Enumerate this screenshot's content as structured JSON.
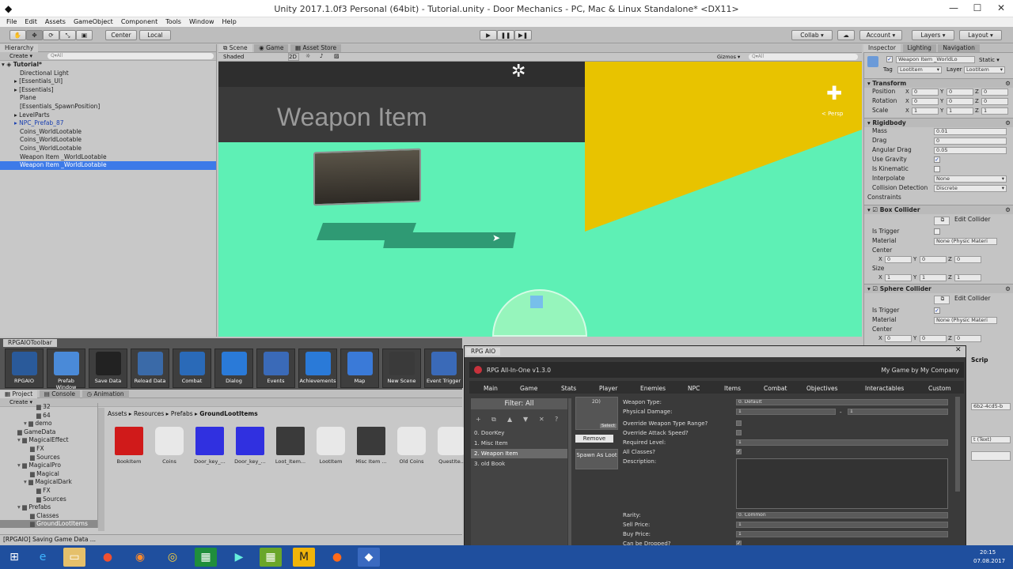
{
  "window": {
    "title": "Unity 2017.1.0f3 Personal (64bit) - Tutorial.unity - Door Mechanics - PC, Mac & Linux Standalone* <DX11>"
  },
  "menu": [
    "File",
    "Edit",
    "Assets",
    "GameObject",
    "Component",
    "Tools",
    "Window",
    "Help"
  ],
  "toolbar": {
    "pivot": "Center",
    "space": "Local",
    "collab": "Collab ▾",
    "account": "Account ▾",
    "layers": "Layers ▾",
    "layout": "Layout ▾"
  },
  "hierarchy": {
    "tab": "Hierarchy",
    "create": "Create ▾",
    "search": "Q▾All",
    "root": "Tutorial*",
    "items": [
      {
        "label": "Directional Light",
        "style": ""
      },
      {
        "label": "[Essentials_UI]",
        "style": ""
      },
      {
        "label": "[Essentials]",
        "style": ""
      },
      {
        "label": "Plane",
        "style": ""
      },
      {
        "label": "[Essentials_SpawnPosition]",
        "style": ""
      },
      {
        "label": "LevelParts",
        "style": ""
      },
      {
        "label": "NPC_Prefab_87",
        "style": "blue"
      },
      {
        "label": "Coins_WorldLootable",
        "style": ""
      },
      {
        "label": "Coins_WorldLootable",
        "style": ""
      },
      {
        "label": "Coins_WorldLootable",
        "style": ""
      },
      {
        "label": "Weapon Item _WorldLootable",
        "style": ""
      },
      {
        "label": "Weapon Item _WorldLootable",
        "style": "sel"
      }
    ]
  },
  "scene": {
    "tabs": [
      "Scene",
      "Game",
      "Asset Store"
    ],
    "shading": "Shaded",
    "mode2d": "2D",
    "gizmos": "Gizmos ▾",
    "search": "Q▾All",
    "label3d": "Weapon Item",
    "persp": "< Persp"
  },
  "inspector": {
    "tabs": [
      "Inspector",
      "Lighting",
      "Navigation"
    ],
    "object_name": "Weapon Item _WorldLo",
    "static": "Static ▾",
    "tag": "LootItem",
    "layer": "LootItem",
    "transform": {
      "title": "Transform",
      "position": [
        "0",
        "0",
        "0"
      ],
      "rotation": [
        "0",
        "0",
        "0"
      ],
      "scale": [
        "1",
        "1",
        "1"
      ]
    },
    "rigidbody": {
      "title": "Rigidbody",
      "mass": "0.01",
      "drag": "0",
      "angular_drag": "0.05",
      "use_gravity": "✓",
      "is_kinematic": "",
      "interpolate": "None",
      "collision_detection": "Discrete",
      "constraints": "Constraints"
    },
    "box_collider": {
      "title": "Box Collider",
      "edit": "Edit Collider",
      "is_trigger": "",
      "material": "None (Physic Materi",
      "center": [
        "0",
        "0",
        "0"
      ],
      "size": [
        "1",
        "1",
        "1"
      ]
    },
    "sphere_collider": {
      "title": "Sphere Collider",
      "edit": "Edit Collider",
      "is_trigger": "✓",
      "material": "None (Physic Materi",
      "center": [
        "0",
        "0",
        "0"
      ]
    },
    "labels": {
      "position": "Position",
      "rotation": "Rotation",
      "scale": "Scale",
      "mass": "Mass",
      "drag": "Drag",
      "angular_drag": "Angular Drag",
      "use_gravity": "Use Gravity",
      "is_kinematic": "Is Kinematic",
      "interpolate": "Interpolate",
      "collision_detection": "Collision Detection",
      "is_trigger": "Is Trigger",
      "material": "Material",
      "center": "Center",
      "size": "Size",
      "tag": "Tag",
      "layer": "Layer"
    },
    "partial": {
      "script": "Scrip",
      "guid": "6b2-4cd5-b",
      "text": "t (Text)"
    }
  },
  "rpg_toolbar": {
    "tab": "RPGAIOToolbar",
    "buttons": [
      "RPGAIO",
      "Prefab Window",
      "Save Data",
      "Reload Data",
      "Combat",
      "Dialog",
      "Events",
      "Achievements",
      "Map",
      "New Scene",
      "Event Trigger"
    ]
  },
  "project": {
    "tabs": [
      "Project",
      "Console",
      "Animation"
    ],
    "create": "Create ▾",
    "tree": [
      "32",
      "64",
      "demo",
      "GameData",
      "MagicalEffect",
      "FX",
      "Sources",
      "MagicalPro",
      "Magical",
      "MagicalDark",
      "FX",
      "Sources",
      "Prefabs",
      "Classes",
      "GroundLootItems"
    ],
    "breadcrumb": [
      "Assets",
      "Resources",
      "Prefabs",
      "GroundLootItems"
    ],
    "assets": [
      "BookItem",
      "Coins",
      "Door_key_...",
      "Door_key_...",
      "Loot_Item...",
      "LootItem",
      "Misc Item ...",
      "Old Coins",
      "QuestIte..."
    ]
  },
  "rpgaio": {
    "tab": "RPG AIO",
    "title": "RPG All-In-One v1.3.0",
    "company": "My Game by My Company",
    "nav": [
      "Main",
      "Game",
      "Stats",
      "Player",
      "Enemies",
      "NPC",
      "Items",
      "Combat",
      "Objectives",
      "Interactables",
      "Custom"
    ],
    "filter": "Filter: All",
    "list_tools": [
      "+",
      "⧉",
      "▲",
      "▼",
      "✕",
      "?"
    ],
    "list": [
      "0. DoorKey",
      "1. Misc Item",
      "2. Weapon Item",
      "3. old Book"
    ],
    "image_label": "2D)",
    "select": "Select",
    "remove": "Remove",
    "spawn": "Spawn As Loot",
    "fields": {
      "weapon_type_label": "Weapon Type:",
      "weapon_type": "0. Default",
      "physical_damage_label": "Physical Damage:",
      "damage_min": "1",
      "damage_sep": "-",
      "damage_max": "1",
      "override_range_label": "Override Weapon Type Range?",
      "override_speed_label": "Override Attack Speed?",
      "required_level_label": "Required Level:",
      "required_level": "1",
      "all_classes_label": "All Classes?",
      "description_label": "Description:",
      "rarity_label": "Rarity:",
      "rarity": "0. Common",
      "sell_price_label": "Sell Price:",
      "sell_price": "1",
      "buy_price_label": "Buy Price:",
      "buy_price": "1",
      "can_drop_label": "Can be Dropped?",
      "run_use_label": "Run Event on Use?",
      "run_pickup_label": "Run Event on Pickup?"
    }
  },
  "status": "[RPGAIO] Saving Game Data ...",
  "clock": {
    "time": "20:15",
    "date": "07.08.2017"
  }
}
